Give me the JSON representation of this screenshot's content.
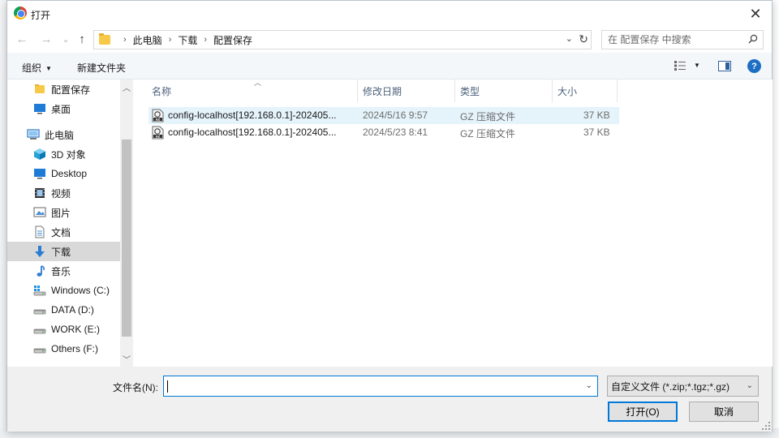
{
  "window": {
    "title": "打开",
    "close_glyph": "✕"
  },
  "nav": {
    "back_glyph": "←",
    "forward_glyph": "→",
    "history_glyph": "⌄",
    "up_glyph": "↑",
    "breadcrumb": [
      "此电脑",
      "下载",
      "配置保存"
    ],
    "breadcrumb_sep": "›",
    "address_dropdown": "⌄",
    "refresh_glyph": "↻",
    "search_placeholder": "在 配置保存 中搜索"
  },
  "toolbar": {
    "organize_label": "组织",
    "new_folder_label": "新建文件夹",
    "help_glyph": "?"
  },
  "sidebar": {
    "items": [
      {
        "label": "配置保存",
        "icon": "folder-icon",
        "indent": 1
      },
      {
        "label": "桌面",
        "icon": "desktop-icon",
        "indent": 1
      },
      {
        "label": "此电脑",
        "icon": "computer-icon",
        "indent": 0
      },
      {
        "label": "3D 对象",
        "icon": "3d-objects-icon",
        "indent": 1
      },
      {
        "label": "Desktop",
        "icon": "desktop-icon",
        "indent": 1
      },
      {
        "label": "视频",
        "icon": "video-icon",
        "indent": 1
      },
      {
        "label": "图片",
        "icon": "pictures-icon",
        "indent": 1
      },
      {
        "label": "文档",
        "icon": "documents-icon",
        "indent": 1
      },
      {
        "label": "下载",
        "icon": "downloads-icon",
        "indent": 1,
        "selected": true
      },
      {
        "label": "音乐",
        "icon": "music-icon",
        "indent": 1
      },
      {
        "label": "Windows (C:)",
        "icon": "windows-drive-icon",
        "indent": 1
      },
      {
        "label": "DATA (D:)",
        "icon": "drive-icon",
        "indent": 1
      },
      {
        "label": "WORK (E:)",
        "icon": "drive-icon",
        "indent": 1
      },
      {
        "label": "Others (F:)",
        "icon": "drive-icon",
        "indent": 1
      }
    ]
  },
  "columns": [
    "名称",
    "修改日期",
    "类型",
    "大小"
  ],
  "files": [
    {
      "name": "config-localhost[192.168.0.1]-202405...",
      "modified": "2024/5/16 9:57",
      "type": "GZ 压缩文件",
      "size": "37 KB",
      "highlighted": true
    },
    {
      "name": "config-localhost[192.168.0.1]-202405...",
      "modified": "2024/5/23 8:41",
      "type": "GZ 压缩文件",
      "size": "37 KB",
      "highlighted": false
    }
  ],
  "footer": {
    "filename_label": "文件名(N):",
    "filename_value": "",
    "filter_value": "自定义文件 (*.zip;*.tgz;*.gz)",
    "open_label": "打开(O)",
    "cancel_label": "取消"
  },
  "colors": {
    "accent": "#0078d7",
    "selection": "#e5f3fb",
    "header_text": "#4c607a"
  }
}
